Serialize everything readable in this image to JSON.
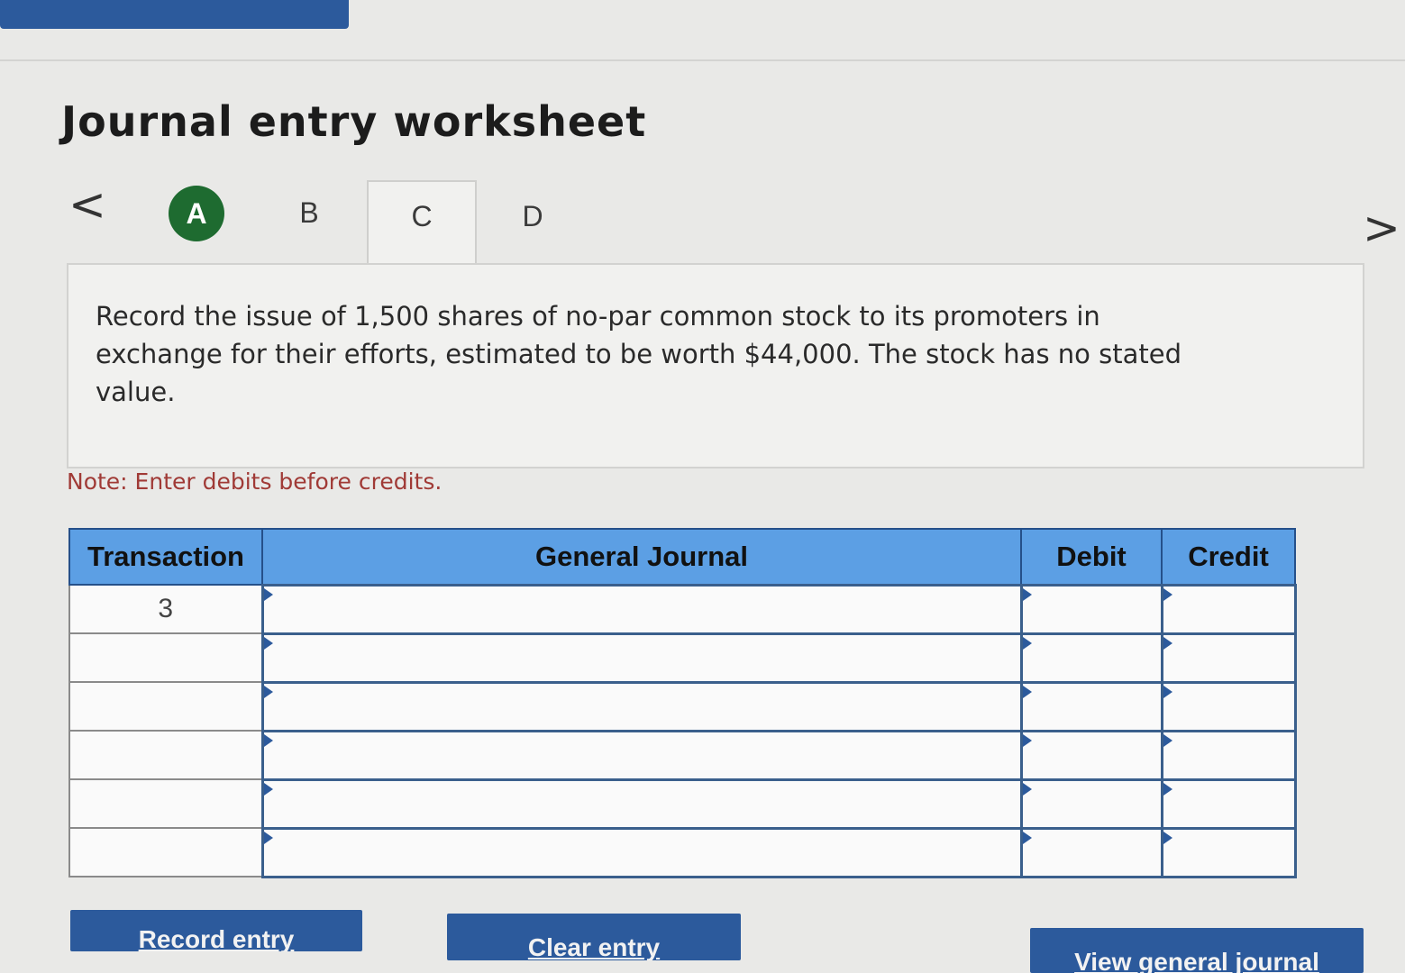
{
  "title": "Journal entry worksheet",
  "nav": {
    "prev_glyph": "<",
    "next_glyph": ">"
  },
  "tabs": [
    {
      "label": "A",
      "state": "completed"
    },
    {
      "label": "B",
      "state": "default"
    },
    {
      "label": "C",
      "state": "active"
    },
    {
      "label": "D",
      "state": "default"
    }
  ],
  "question": "Record the issue of 1,500 shares of no-par common stock to its promoters in exchange for their efforts, estimated to be worth $44,000. The stock has no stated value.",
  "note": "Note: Enter debits before credits.",
  "table": {
    "headers": {
      "transaction": "Transaction",
      "general_journal": "General Journal",
      "debit": "Debit",
      "credit": "Credit"
    },
    "rows": [
      {
        "transaction": "3",
        "account": "",
        "debit": "",
        "credit": ""
      },
      {
        "transaction": "",
        "account": "",
        "debit": "",
        "credit": ""
      },
      {
        "transaction": "",
        "account": "",
        "debit": "",
        "credit": ""
      },
      {
        "transaction": "",
        "account": "",
        "debit": "",
        "credit": ""
      },
      {
        "transaction": "",
        "account": "",
        "debit": "",
        "credit": ""
      },
      {
        "transaction": "",
        "account": "",
        "debit": "",
        "credit": ""
      }
    ]
  },
  "buttons": {
    "record": "Record entry",
    "clear": "Clear entry",
    "view": "View general journal"
  },
  "colors": {
    "header_blue": "#5c9fe4",
    "button_blue": "#2c5a9c",
    "tab_complete_green": "#1e6b30",
    "note_red": "#a03a36"
  }
}
